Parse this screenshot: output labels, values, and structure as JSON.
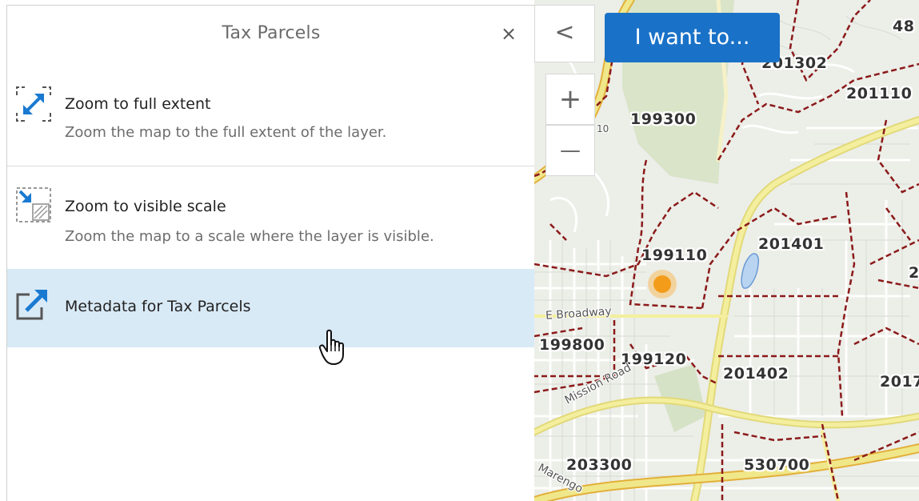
{
  "panel": {
    "title": "Tax Parcels",
    "close_symbol": "×",
    "items": [
      {
        "icon": "zoom-full-extent-icon",
        "title": "Zoom to full extent",
        "description": "Zoom the map to the full extent of the layer."
      },
      {
        "icon": "zoom-visible-scale-icon",
        "title": "Zoom to visible scale",
        "description": "Zoom the map to a scale where the layer is visible."
      },
      {
        "icon": "external-link-icon",
        "title": "Metadata for Tax Parcels",
        "description": ""
      }
    ]
  },
  "map": {
    "collapse_symbol": "<",
    "zoom_in_symbol": "+",
    "zoom_out_symbol": "—",
    "want_button": "I want to...",
    "parcel_labels": [
      "48",
      "201302",
      "201110",
      "199300",
      "201401",
      "199110",
      "2",
      "199800",
      "199120",
      "201402",
      "2017",
      "203300",
      "530700"
    ],
    "street_labels": [
      "E Broadway",
      "Mission Road",
      "Marengo",
      "10"
    ]
  },
  "colors": {
    "accent": "#1a72c8",
    "highlight_row": "#d9eaf7",
    "parcel_boundary": "#8b1a1a",
    "major_road": "#f0e78a",
    "road_casing": "#e2b03a",
    "location_marker": "#f39c1a"
  }
}
